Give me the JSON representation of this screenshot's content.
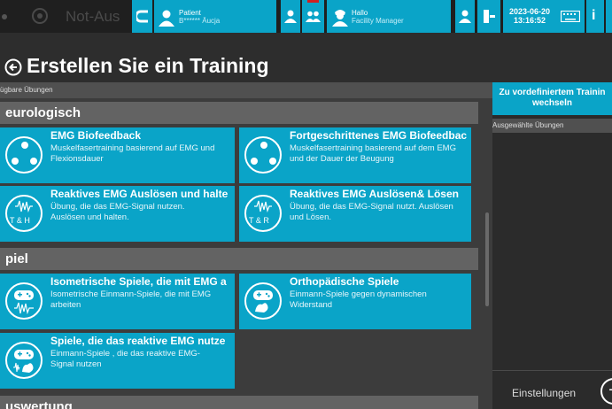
{
  "header": {
    "not_aus_label": "Not-Aus",
    "patient_label": "Patient",
    "patient_name": "B****** Äucja",
    "greeting_label": "Hallo",
    "user_role": "Facility Manager",
    "date": "2023-06-20",
    "time": "13:16:52"
  },
  "page": {
    "title": "Erstellen Sie ein Training"
  },
  "left_panel": {
    "header": "ügbare Übungen",
    "sections": [
      {
        "label": "eurologisch",
        "cards": [
          {
            "title": "EMG Biofeedback",
            "desc": "Muskelfasertraining basierend auf EMG und Flexionsdauer",
            "icon": "dots-icon"
          },
          {
            "title": "Fortgeschrittenes EMG Biofeedbac",
            "desc": "Muskelfasertraining basierend auf dem EMG und der Dauer der Beugung",
            "icon": "dots-icon"
          },
          {
            "title": "Reaktives EMG Auslösen und halte",
            "desc": "Übung, die das EMG-Signal nutzen. Auslösen und halten.",
            "icon": "emg-wave-icon",
            "icon_text": "T & H"
          },
          {
            "title": "Reaktives EMG Auslösen& Lösen",
            "desc": "Übung, die das EMG-Signal nutzt. Auslösen und Lösen.",
            "icon": "emg-wave-icon",
            "icon_text": "T & R"
          }
        ]
      },
      {
        "label": "piel",
        "cards": [
          {
            "title": "Isometrische Spiele, die mit EMG a",
            "desc": "Isometrische Einmann-Spiele, die mit EMG arbeiten",
            "icon": "gamepad-icon"
          },
          {
            "title": "Orthopädische Spiele",
            "desc": "Einmann-Spiele gegen dynamischen Widerstand",
            "icon": "gamepad-arm-icon"
          },
          {
            "title": "Spiele, die das reaktive EMG nutze",
            "desc": "Einmann-Spiele , die das reaktive EMG-Signal nutzen",
            "icon": "gamepad-wave-icon"
          }
        ]
      },
      {
        "label": "uswertung",
        "cards": []
      }
    ]
  },
  "right_panel": {
    "switch_button": "Zu vordefiniertem Trainin wechseln",
    "switch_line1": "Zu vordefiniertem Trainin",
    "switch_line2": "wechseln",
    "selected_header": "Ausgewählte Übungen",
    "settings_label": "Einstellungen"
  },
  "colors": {
    "accent": "#0aa4c8",
    "background": "#2d2d2d",
    "topbar": "#1f1f1f",
    "section": "#636363"
  }
}
